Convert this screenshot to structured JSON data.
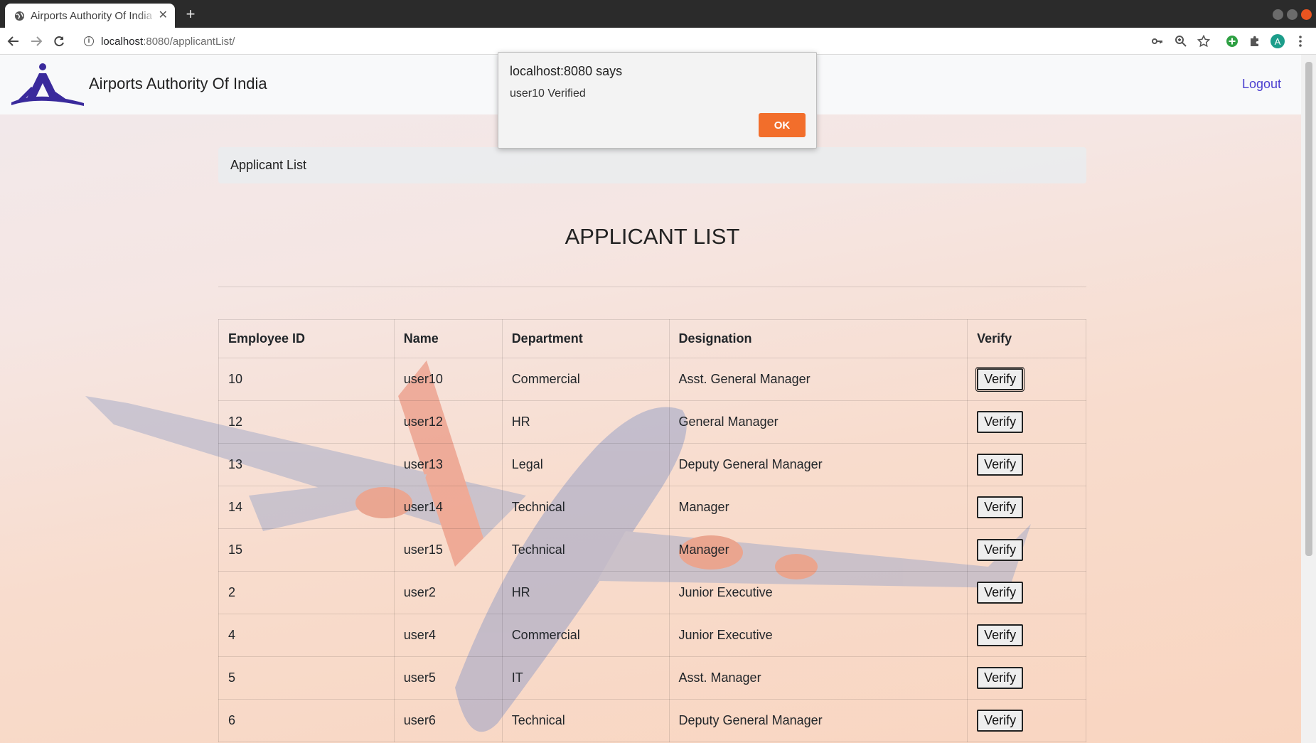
{
  "browser": {
    "tab_title": "Airports Authority Of India",
    "url_host": "localhost",
    "url_rest": ":8080/applicantList/",
    "new_tab": "+",
    "profile_initial": "A"
  },
  "navbar": {
    "brand": "Airports Authority Of India",
    "logout": "Logout"
  },
  "breadcrumb": "Applicant List",
  "heading": "APPLICANT LIST",
  "table": {
    "headers": [
      "Employee ID",
      "Name",
      "Department",
      "Designation",
      "Verify"
    ],
    "rows": [
      {
        "id": "10",
        "name": "user10",
        "department": "Commercial",
        "designation": "Asst. General Manager",
        "action": "Verify"
      },
      {
        "id": "12",
        "name": "user12",
        "department": "HR",
        "designation": "General Manager",
        "action": "Verify"
      },
      {
        "id": "13",
        "name": "user13",
        "department": "Legal",
        "designation": "Deputy General Manager",
        "action": "Verify"
      },
      {
        "id": "14",
        "name": "user14",
        "department": "Technical",
        "designation": "Manager",
        "action": "Verify"
      },
      {
        "id": "15",
        "name": "user15",
        "department": "Technical",
        "designation": "Manager",
        "action": "Verify"
      },
      {
        "id": "2",
        "name": "user2",
        "department": "HR",
        "designation": "Junior Executive",
        "action": "Verify"
      },
      {
        "id": "4",
        "name": "user4",
        "department": "Commercial",
        "designation": "Junior Executive",
        "action": "Verify"
      },
      {
        "id": "5",
        "name": "user5",
        "department": "IT",
        "designation": "Asst. Manager",
        "action": "Verify"
      },
      {
        "id": "6",
        "name": "user6",
        "department": "Technical",
        "designation": "Deputy General Manager",
        "action": "Verify"
      }
    ]
  },
  "alert": {
    "title": "localhost:8080 says",
    "message": "user10 Verified",
    "ok": "OK"
  },
  "colors": {
    "accent": "#f26e2b",
    "brand_purple": "#3a2a9c",
    "link": "#4b3fd0"
  }
}
